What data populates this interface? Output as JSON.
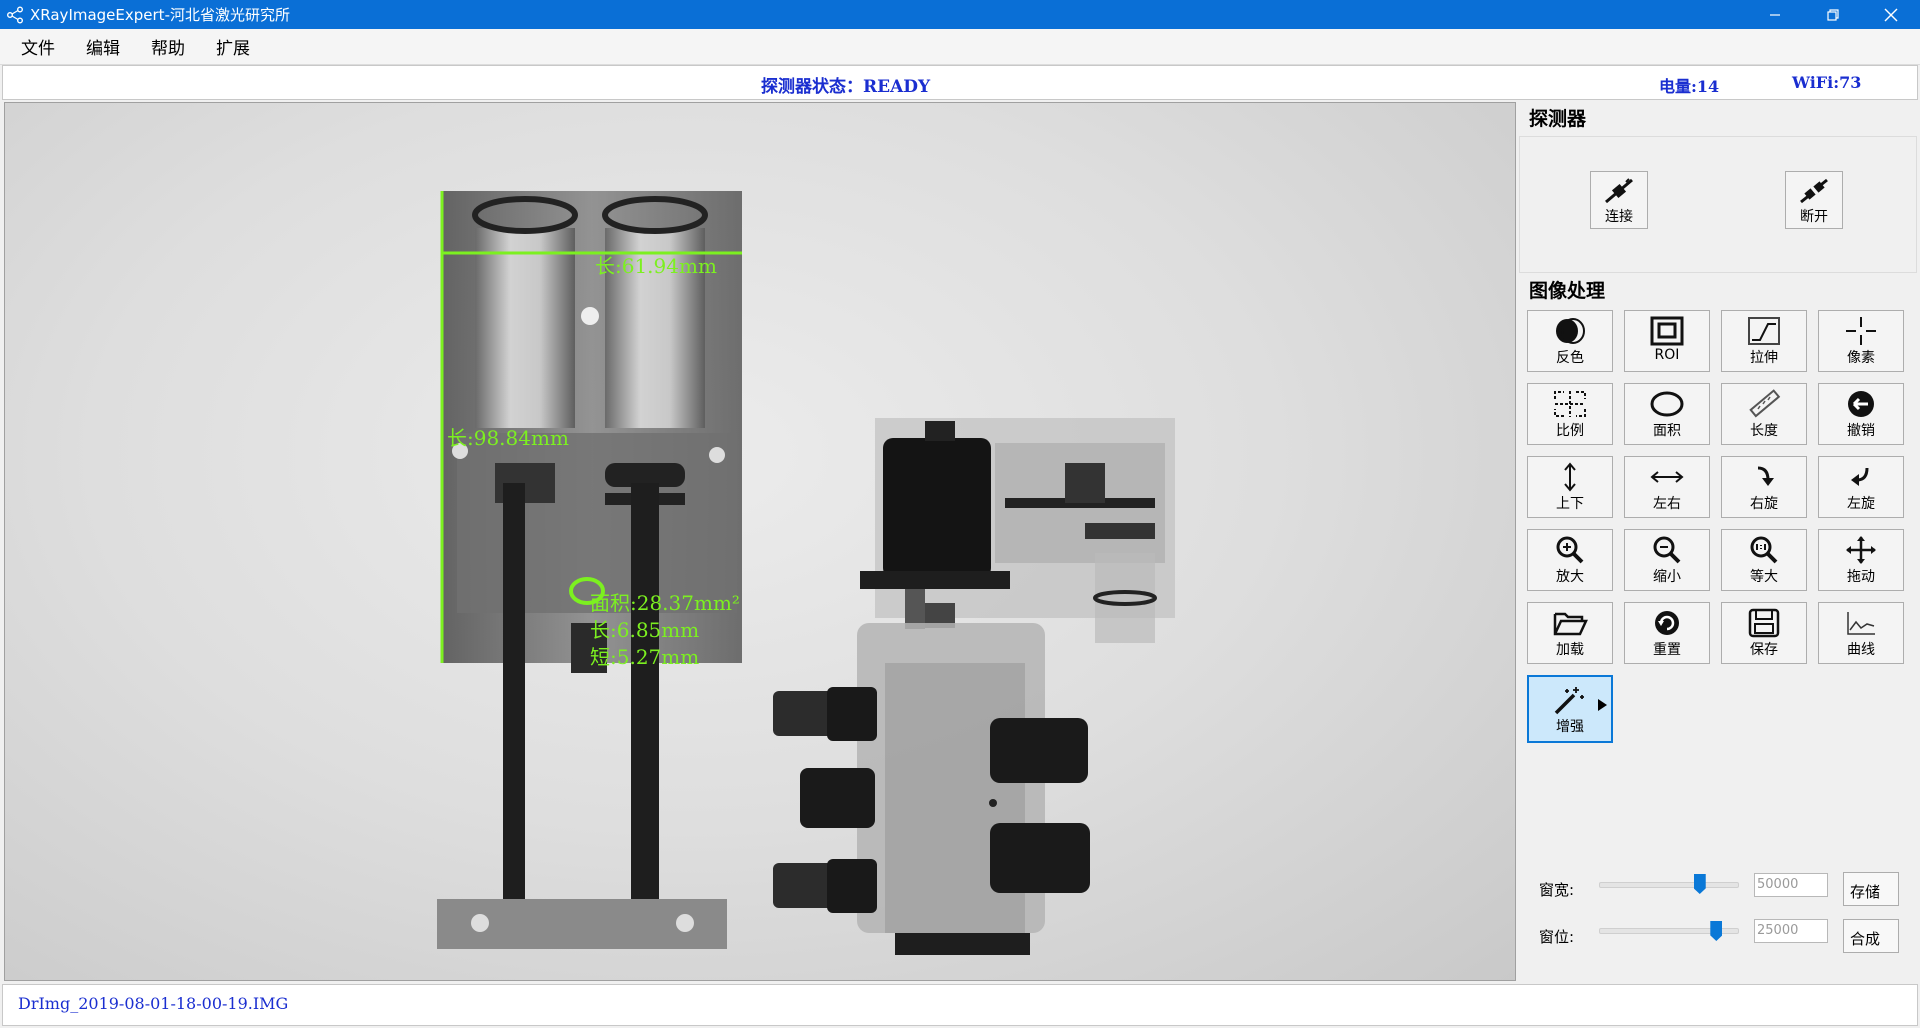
{
  "window": {
    "title": "XRayImageExpert-河北省激光研究所"
  },
  "menu": {
    "items": [
      "文件",
      "编辑",
      "帮助",
      "扩展"
    ]
  },
  "status": {
    "detector_status": "探测器状态：READY",
    "battery": "电量:14",
    "wifi": "WiFi:73",
    "accent_color": "#1a2ed0"
  },
  "viewer": {
    "measurements": {
      "length_top": "长:61.94mm",
      "length_left": "长:98.84mm",
      "area": "面积:28.37mm²",
      "area_length": "长:6.85mm",
      "area_short": "短:5.27mm"
    },
    "annotation_color": "#7cf020"
  },
  "panel": {
    "detector": {
      "title": "探测器",
      "connect_label": "连接",
      "disconnect_label": "断开"
    },
    "image_processing": {
      "title": "图像处理",
      "tools": [
        {
          "label": "反色",
          "icon": "invert-icon"
        },
        {
          "label": "ROI",
          "icon": "roi-icon"
        },
        {
          "label": "拉伸",
          "icon": "stretch-icon"
        },
        {
          "label": "像素",
          "icon": "pixel-icon"
        },
        {
          "label": "比例",
          "icon": "scale-icon"
        },
        {
          "label": "面积",
          "icon": "area-icon"
        },
        {
          "label": "长度",
          "icon": "ruler-icon"
        },
        {
          "label": "撤销",
          "icon": "undo-icon"
        },
        {
          "label": "上下",
          "icon": "flip-vertical-icon"
        },
        {
          "label": "左右",
          "icon": "flip-horizontal-icon"
        },
        {
          "label": "右旋",
          "icon": "rotate-right-icon"
        },
        {
          "label": "左旋",
          "icon": "rotate-left-icon"
        },
        {
          "label": "放大",
          "icon": "zoom-in-icon"
        },
        {
          "label": "缩小",
          "icon": "zoom-out-icon"
        },
        {
          "label": "等大",
          "icon": "zoom-actual-icon"
        },
        {
          "label": "拖动",
          "icon": "move-icon"
        },
        {
          "label": "加载",
          "icon": "folder-open-icon"
        },
        {
          "label": "重置",
          "icon": "reset-icon"
        },
        {
          "label": "保存",
          "icon": "save-icon"
        },
        {
          "label": "曲线",
          "icon": "curve-icon"
        },
        {
          "label": "增强",
          "icon": "magic-wand-icon"
        }
      ]
    },
    "window_level": {
      "width_label": "窗宽:",
      "width_value": "50000",
      "width_button": "存储",
      "level_label": "窗位:",
      "level_value": "25000",
      "level_button": "合成",
      "width_slider_fraction": 0.73,
      "level_slider_fraction": 0.85
    }
  },
  "footer": {
    "filename": "DrImg_2019-08-01-18-00-19.IMG"
  }
}
